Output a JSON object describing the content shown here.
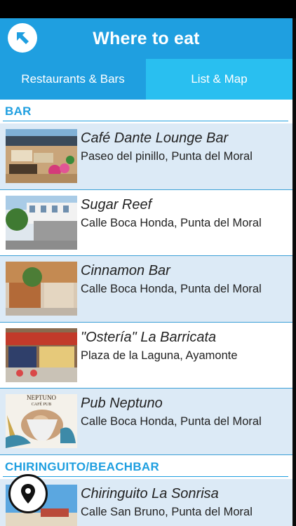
{
  "header": {
    "title": "Where to eat"
  },
  "tabs": [
    {
      "label": "Restaurants & Bars"
    },
    {
      "label": "List & Map"
    }
  ],
  "sections": [
    {
      "title": "BAR",
      "items": [
        {
          "name": "Café Dante Lounge Bar",
          "address": "Paseo del pinillo, Punta del Moral"
        },
        {
          "name": "Sugar Reef",
          "address": "Calle Boca Honda, Punta del Moral"
        },
        {
          "name": "Cinnamon Bar",
          "address": "Calle Boca Honda, Punta del Moral"
        },
        {
          "name": "\"Ostería\" La Barricata",
          "address": "Plaza de la Laguna, Ayamonte"
        },
        {
          "name": "Pub Neptuno",
          "address": "Calle Boca Honda, Punta del Moral"
        }
      ]
    },
    {
      "title": "CHIRINGUITO/BEACHBAR",
      "items": [
        {
          "name": "Chiringuito La Sonrisa",
          "address": "Calle San Bruno, Punta del Moral"
        }
      ]
    }
  ],
  "thumb_text": {
    "neptuno_sign": "NEPTUNO",
    "neptuno_sub": "CAFÉ PUB"
  },
  "colors": {
    "accent": "#1f9fe0",
    "tab_active": "#29bff0",
    "row_alt": "#dceaf6"
  }
}
